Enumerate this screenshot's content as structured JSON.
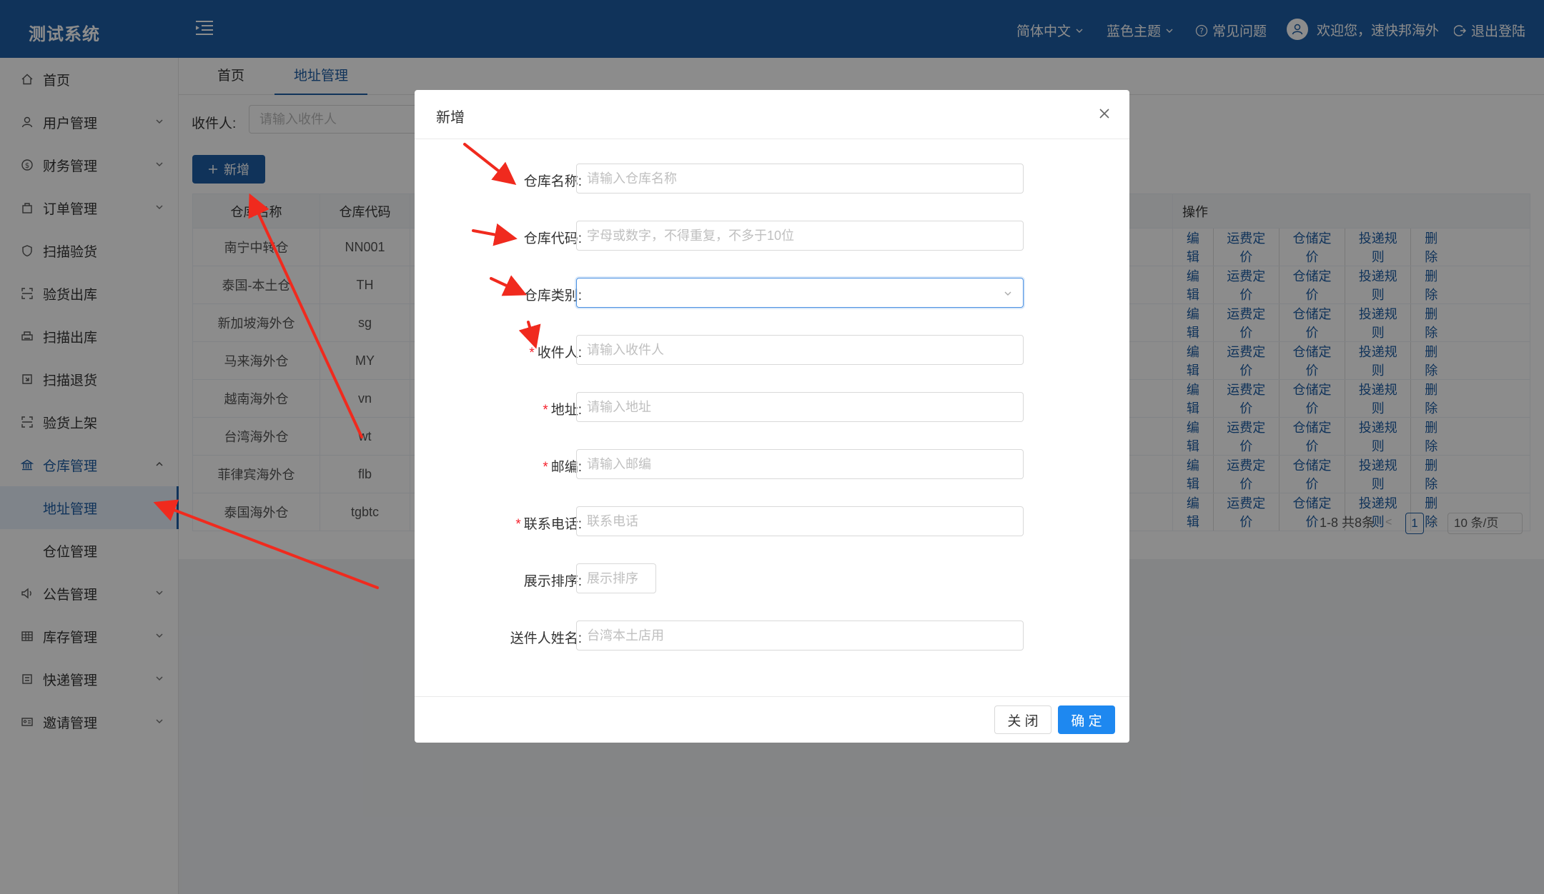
{
  "app": {
    "title": "测试系统"
  },
  "header": {
    "language": "简体中文",
    "theme": "蓝色主题",
    "faq": "常见问题",
    "welcome": "欢迎您，速快邦海外",
    "logout": "退出登陆"
  },
  "sidebar": {
    "items": [
      {
        "label": "首页",
        "icon": "home-icon"
      },
      {
        "label": "用户管理",
        "icon": "user-icon"
      },
      {
        "label": "财务管理",
        "icon": "finance-icon"
      },
      {
        "label": "订单管理",
        "icon": "order-icon"
      },
      {
        "label": "扫描验货",
        "icon": "shield-icon"
      },
      {
        "label": "验货出库",
        "icon": "scan-icon"
      },
      {
        "label": "扫描出库",
        "icon": "printer-icon"
      },
      {
        "label": "扫描退货",
        "icon": "return-icon"
      },
      {
        "label": "验货上架",
        "icon": "scan-icon"
      },
      {
        "label": "仓库管理",
        "icon": "bank-icon"
      },
      {
        "label": "地址管理"
      },
      {
        "label": "仓位管理"
      },
      {
        "label": "公告管理",
        "icon": "sound-icon"
      },
      {
        "label": "库存管理",
        "icon": "table-icon"
      },
      {
        "label": "快递管理",
        "icon": "express-icon"
      },
      {
        "label": "邀请管理",
        "icon": "id-card-icon"
      }
    ]
  },
  "tabs": [
    "首页",
    "地址管理"
  ],
  "filter": {
    "label": "收件人:",
    "placeholder": "请输入收件人"
  },
  "add_button": "新增",
  "table": {
    "headers": [
      "仓库名称",
      "仓库代码",
      "操作"
    ],
    "rows": [
      [
        "南宁中转仓",
        "NN001"
      ],
      [
        "泰国-本土仓",
        "TH"
      ],
      [
        "新加坡海外仓",
        "sg"
      ],
      [
        "马来海外仓",
        "MY"
      ],
      [
        "越南海外仓",
        "vn"
      ],
      [
        "台湾海外仓",
        "wt"
      ],
      [
        "菲律宾海外仓",
        "flb"
      ],
      [
        "泰国海外仓",
        "tgbtc"
      ]
    ],
    "actions": [
      "编辑",
      "运费定价",
      "仓储定价",
      "投递规则",
      "删除"
    ]
  },
  "pagination": {
    "summary": "1-8 共8条",
    "current": "1",
    "page_size": "10 条/页"
  },
  "modal": {
    "title": "新增",
    "fields": [
      {
        "label": "仓库名称:",
        "placeholder": "请输入仓库名称",
        "required": false
      },
      {
        "label": "仓库代码:",
        "placeholder": "字母或数字，不得重复，不多于10位",
        "required": false
      },
      {
        "label": "仓库类别:",
        "placeholder": "",
        "required": false
      },
      {
        "label": "收件人:",
        "placeholder": "请输入收件人",
        "required": true
      },
      {
        "label": "地址:",
        "placeholder": "请输入地址",
        "required": true
      },
      {
        "label": "邮编:",
        "placeholder": "请输入邮编",
        "required": true
      },
      {
        "label": "联系电话:",
        "placeholder": "联系电话",
        "required": true
      },
      {
        "label": "展示排序:",
        "placeholder": "展示排序",
        "required": false
      },
      {
        "label": "送件人姓名:",
        "placeholder": "台湾本土店用",
        "required": false
      }
    ],
    "close_label": "关 闭",
    "ok_label": "确 定"
  },
  "colors": {
    "brand": "#1e5da4",
    "primary_button": "#1e88f0",
    "annotation_arrow": "#f02a1e"
  }
}
